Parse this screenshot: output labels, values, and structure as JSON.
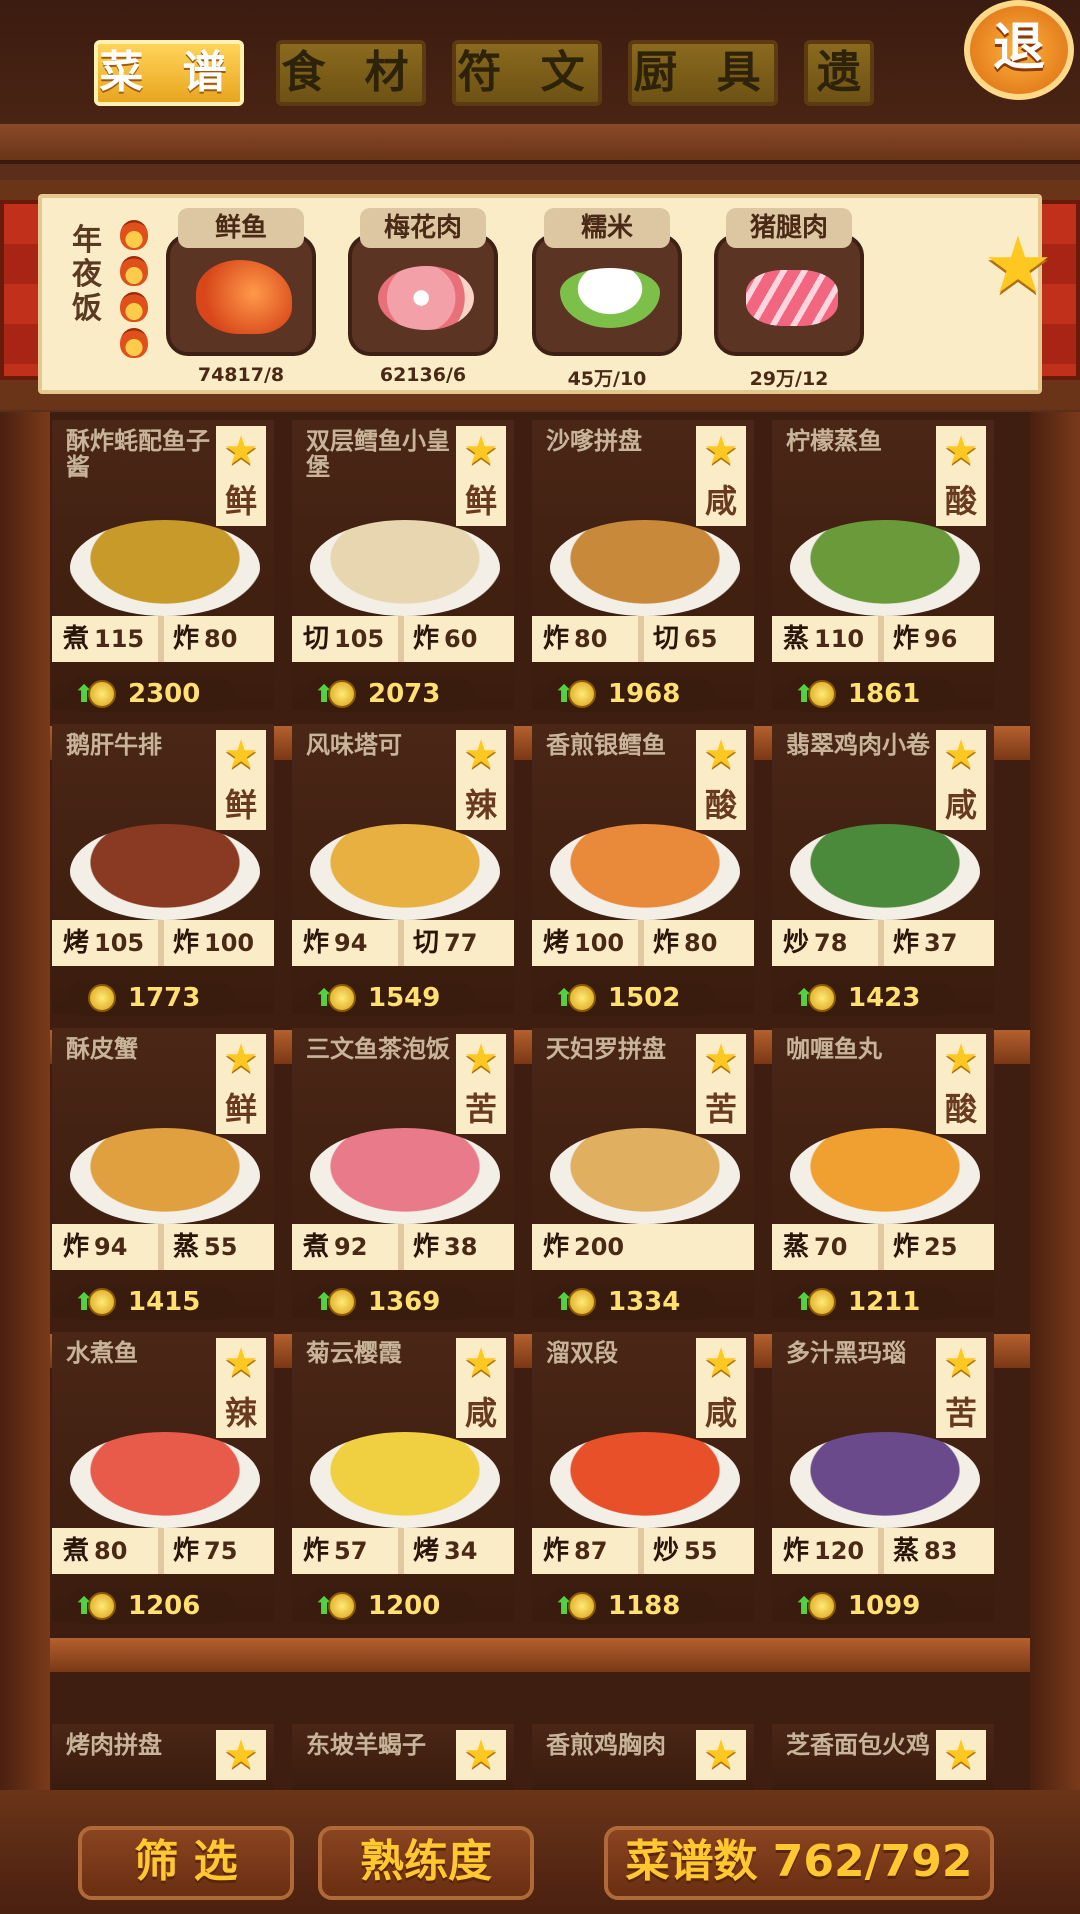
{
  "tabs": [
    "菜 谱",
    "食 材",
    "符 文",
    "厨 具",
    "遗"
  ],
  "quit_label": "退",
  "feast": {
    "title": "年夜饭",
    "ingredients": [
      {
        "name": "鲜鱼",
        "count": "74817/8"
      },
      {
        "name": "梅花肉",
        "count": "62136/6"
      },
      {
        "name": "糯米",
        "count": "45万/10"
      },
      {
        "name": "猪腿肉",
        "count": "29万/12"
      }
    ],
    "star": "★"
  },
  "recipes": [
    {
      "name": "酥炸蚝配鱼子酱",
      "flavor": "鲜",
      "s1k": "煮",
      "s1v": "115",
      "s2k": "炸",
      "s2v": "80",
      "price": "2300",
      "up": true,
      "color": "#c79a2a"
    },
    {
      "name": "双层鳕鱼小皇堡",
      "flavor": "鲜",
      "s1k": "切",
      "s1v": "105",
      "s2k": "炸",
      "s2v": "60",
      "price": "2073",
      "up": true,
      "color": "#e8d6b0"
    },
    {
      "name": "沙嗲拼盘",
      "flavor": "咸",
      "s1k": "炸",
      "s1v": "80",
      "s2k": "切",
      "s2v": "65",
      "price": "1968",
      "up": true,
      "color": "#c88a3a"
    },
    {
      "name": "柠檬蒸鱼",
      "flavor": "酸",
      "s1k": "蒸",
      "s1v": "110",
      "s2k": "炸",
      "s2v": "96",
      "price": "1861",
      "up": true,
      "color": "#6a9a3a"
    },
    {
      "name": "鹅肝牛排",
      "flavor": "鲜",
      "s1k": "烤",
      "s1v": "105",
      "s2k": "炸",
      "s2v": "100",
      "price": "1773",
      "up": false,
      "color": "#8a3a22"
    },
    {
      "name": "风味塔可",
      "flavor": "辣",
      "s1k": "炸",
      "s1v": "94",
      "s2k": "切",
      "s2v": "77",
      "price": "1549",
      "up": true,
      "color": "#e8b040"
    },
    {
      "name": "香煎银鳕鱼",
      "flavor": "酸",
      "s1k": "烤",
      "s1v": "100",
      "s2k": "炸",
      "s2v": "80",
      "price": "1502",
      "up": true,
      "color": "#e88a3a"
    },
    {
      "name": "翡翠鸡肉小卷",
      "flavor": "咸",
      "s1k": "炒",
      "s1v": "78",
      "s2k": "炸",
      "s2v": "37",
      "price": "1423",
      "up": true,
      "color": "#4a8a3a"
    },
    {
      "name": "酥皮蟹",
      "flavor": "鲜",
      "s1k": "炸",
      "s1v": "94",
      "s2k": "蒸",
      "s2v": "55",
      "price": "1415",
      "up": true,
      "color": "#e0a040"
    },
    {
      "name": "三文鱼茶泡饭",
      "flavor": "苦",
      "s1k": "煮",
      "s1v": "92",
      "s2k": "炸",
      "s2v": "38",
      "price": "1369",
      "up": true,
      "color": "#e87a8a"
    },
    {
      "name": "天妇罗拼盘",
      "flavor": "苦",
      "s1k": "炸",
      "s1v": "200",
      "s2k": "",
      "s2v": "",
      "price": "1334",
      "up": true,
      "color": "#e0b060"
    },
    {
      "name": "咖喱鱼丸",
      "flavor": "酸",
      "s1k": "蒸",
      "s1v": "70",
      "s2k": "炸",
      "s2v": "25",
      "price": "1211",
      "up": true,
      "color": "#f0a030"
    },
    {
      "name": "水煮鱼",
      "flavor": "辣",
      "s1k": "煮",
      "s1v": "80",
      "s2k": "炸",
      "s2v": "75",
      "price": "1206",
      "up": true,
      "color": "#e85a4a"
    },
    {
      "name": "菊云樱霞",
      "flavor": "咸",
      "s1k": "炸",
      "s1v": "57",
      "s2k": "烤",
      "s2v": "34",
      "price": "1200",
      "up": true,
      "color": "#f0d040"
    },
    {
      "name": "溜双段",
      "flavor": "咸",
      "s1k": "炸",
      "s1v": "87",
      "s2k": "炒",
      "s2v": "55",
      "price": "1188",
      "up": true,
      "color": "#e8502a"
    },
    {
      "name": "多汁黑玛瑙",
      "flavor": "苦",
      "s1k": "炸",
      "s1v": "120",
      "s2k": "蒸",
      "s2v": "83",
      "price": "1099",
      "up": true,
      "color": "#6a4a8a"
    }
  ],
  "partial_recipes": [
    "烤肉拼盘",
    "东坡羊蝎子",
    "香煎鸡胸肉",
    "芝香面包火鸡"
  ],
  "bottom": {
    "filter": "筛 选",
    "proficiency": "熟练度",
    "count": "菜谱数 762/792"
  }
}
